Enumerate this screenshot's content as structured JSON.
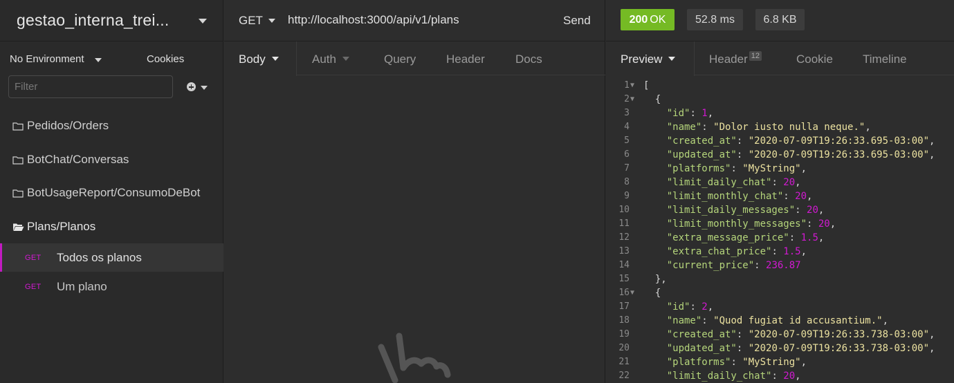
{
  "workspace": {
    "title": "gestao_interna_trei..."
  },
  "environment": {
    "label": "No Environment",
    "cookies_label": "Cookies"
  },
  "filter": {
    "placeholder": "Filter"
  },
  "folders": [
    {
      "label": "Pedidos/Orders",
      "open": false
    },
    {
      "label": "BotChat/Conversas",
      "open": false
    },
    {
      "label": "BotUsageReport/ConsumoDeBot",
      "open": false
    },
    {
      "label": "Plans/Planos",
      "open": true
    }
  ],
  "requests": [
    {
      "method": "GET",
      "name": "Todos os planos",
      "active": true
    },
    {
      "method": "GET",
      "name": "Um plano",
      "active": false
    }
  ],
  "request_bar": {
    "method": "GET",
    "url": "http://localhost:3000/api/v1/plans",
    "send_label": "Send"
  },
  "request_tabs": [
    "Body",
    "Auth",
    "Query",
    "Header",
    "Docs"
  ],
  "response": {
    "status_code": "200",
    "status_text": "OK",
    "time": "52.8 ms",
    "size": "6.8 KB",
    "accent_color": "#75ba24"
  },
  "response_tabs": {
    "preview": "Preview",
    "header": "Header",
    "header_count": "12",
    "cookie": "Cookie",
    "timeline": "Timeline"
  },
  "code_lines": [
    {
      "n": "1",
      "fold": true,
      "tokens": [
        [
          "p",
          "["
        ]
      ]
    },
    {
      "n": "2",
      "fold": true,
      "tokens": [
        [
          "p",
          "  {"
        ]
      ]
    },
    {
      "n": "3",
      "tokens": [
        [
          "p",
          "    "
        ],
        [
          "k",
          "\"id\""
        ],
        [
          "p",
          ": "
        ],
        [
          "n",
          "1"
        ],
        [
          "p",
          ","
        ]
      ]
    },
    {
      "n": "4",
      "tokens": [
        [
          "p",
          "    "
        ],
        [
          "k",
          "\"name\""
        ],
        [
          "p",
          ": "
        ],
        [
          "s",
          "\"Dolor iusto nulla neque.\""
        ],
        [
          "p",
          ","
        ]
      ]
    },
    {
      "n": "5",
      "tokens": [
        [
          "p",
          "    "
        ],
        [
          "k",
          "\"created_at\""
        ],
        [
          "p",
          ": "
        ],
        [
          "s",
          "\"2020-07-09T19:26:33.695-03:00\""
        ],
        [
          "p",
          ","
        ]
      ]
    },
    {
      "n": "6",
      "tokens": [
        [
          "p",
          "    "
        ],
        [
          "k",
          "\"updated_at\""
        ],
        [
          "p",
          ": "
        ],
        [
          "s",
          "\"2020-07-09T19:26:33.695-03:00\""
        ],
        [
          "p",
          ","
        ]
      ]
    },
    {
      "n": "7",
      "tokens": [
        [
          "p",
          "    "
        ],
        [
          "k",
          "\"platforms\""
        ],
        [
          "p",
          ": "
        ],
        [
          "s",
          "\"MyString\""
        ],
        [
          "p",
          ","
        ]
      ]
    },
    {
      "n": "8",
      "tokens": [
        [
          "p",
          "    "
        ],
        [
          "k",
          "\"limit_daily_chat\""
        ],
        [
          "p",
          ": "
        ],
        [
          "n",
          "20"
        ],
        [
          "p",
          ","
        ]
      ]
    },
    {
      "n": "9",
      "tokens": [
        [
          "p",
          "    "
        ],
        [
          "k",
          "\"limit_monthly_chat\""
        ],
        [
          "p",
          ": "
        ],
        [
          "n",
          "20"
        ],
        [
          "p",
          ","
        ]
      ]
    },
    {
      "n": "10",
      "tokens": [
        [
          "p",
          "    "
        ],
        [
          "k",
          "\"limit_daily_messages\""
        ],
        [
          "p",
          ": "
        ],
        [
          "n",
          "20"
        ],
        [
          "p",
          ","
        ]
      ]
    },
    {
      "n": "11",
      "tokens": [
        [
          "p",
          "    "
        ],
        [
          "k",
          "\"limit_monthly_messages\""
        ],
        [
          "p",
          ": "
        ],
        [
          "n",
          "20"
        ],
        [
          "p",
          ","
        ]
      ]
    },
    {
      "n": "12",
      "tokens": [
        [
          "p",
          "    "
        ],
        [
          "k",
          "\"extra_message_price\""
        ],
        [
          "p",
          ": "
        ],
        [
          "n",
          "1.5"
        ],
        [
          "p",
          ","
        ]
      ]
    },
    {
      "n": "13",
      "tokens": [
        [
          "p",
          "    "
        ],
        [
          "k",
          "\"extra_chat_price\""
        ],
        [
          "p",
          ": "
        ],
        [
          "n",
          "1.5"
        ],
        [
          "p",
          ","
        ]
      ]
    },
    {
      "n": "14",
      "tokens": [
        [
          "p",
          "    "
        ],
        [
          "k",
          "\"current_price\""
        ],
        [
          "p",
          ": "
        ],
        [
          "n",
          "236.87"
        ]
      ]
    },
    {
      "n": "15",
      "tokens": [
        [
          "p",
          "  },"
        ]
      ]
    },
    {
      "n": "16",
      "fold": true,
      "tokens": [
        [
          "p",
          "  {"
        ]
      ]
    },
    {
      "n": "17",
      "tokens": [
        [
          "p",
          "    "
        ],
        [
          "k",
          "\"id\""
        ],
        [
          "p",
          ": "
        ],
        [
          "n",
          "2"
        ],
        [
          "p",
          ","
        ]
      ]
    },
    {
      "n": "18",
      "tokens": [
        [
          "p",
          "    "
        ],
        [
          "k",
          "\"name\""
        ],
        [
          "p",
          ": "
        ],
        [
          "s",
          "\"Quod fugiat id accusantium.\""
        ],
        [
          "p",
          ","
        ]
      ]
    },
    {
      "n": "19",
      "tokens": [
        [
          "p",
          "    "
        ],
        [
          "k",
          "\"created_at\""
        ],
        [
          "p",
          ": "
        ],
        [
          "s",
          "\"2020-07-09T19:26:33.738-03:00\""
        ],
        [
          "p",
          ","
        ]
      ]
    },
    {
      "n": "20",
      "tokens": [
        [
          "p",
          "    "
        ],
        [
          "k",
          "\"updated_at\""
        ],
        [
          "p",
          ": "
        ],
        [
          "s",
          "\"2020-07-09T19:26:33.738-03:00\""
        ],
        [
          "p",
          ","
        ]
      ]
    },
    {
      "n": "21",
      "tokens": [
        [
          "p",
          "    "
        ],
        [
          "k",
          "\"platforms\""
        ],
        [
          "p",
          ": "
        ],
        [
          "s",
          "\"MyString\""
        ],
        [
          "p",
          ","
        ]
      ]
    },
    {
      "n": "22",
      "tokens": [
        [
          "p",
          "    "
        ],
        [
          "k",
          "\"limit_daily_chat\""
        ],
        [
          "p",
          ": "
        ],
        [
          "n",
          "20"
        ],
        [
          "p",
          ","
        ]
      ]
    }
  ]
}
